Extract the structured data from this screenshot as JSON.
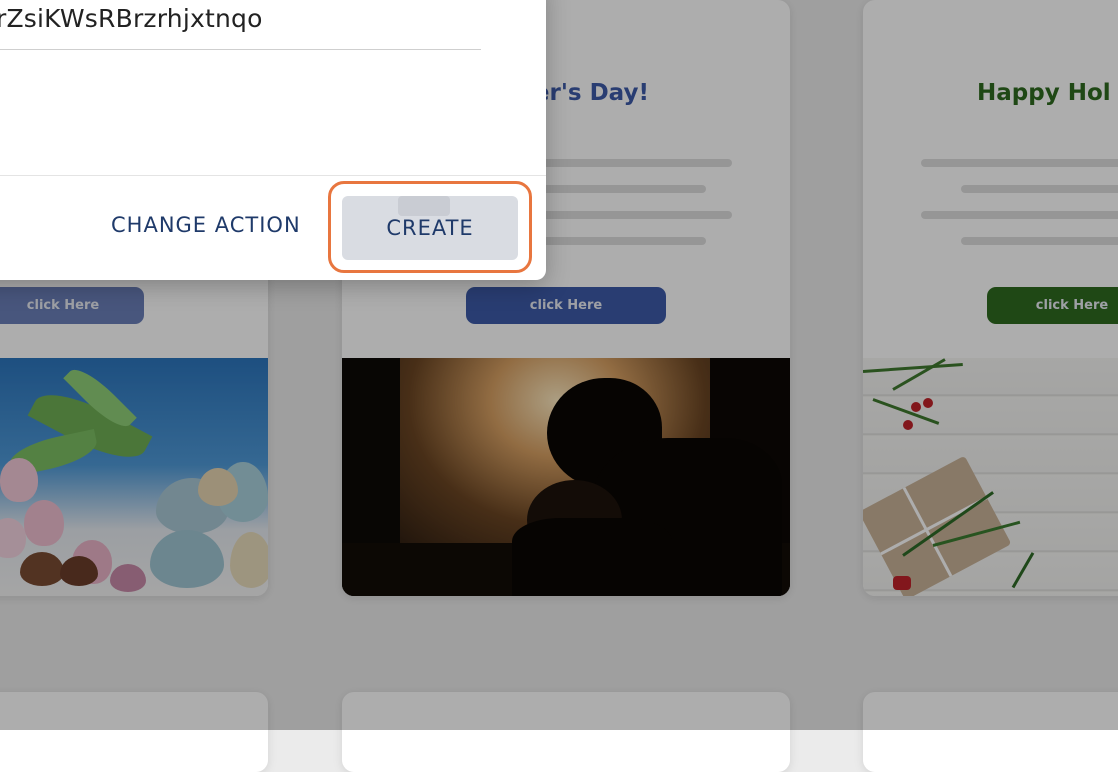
{
  "dialog": {
    "name_value": "rZsiKWsRBrzrhjxtnqo",
    "change_action_label": "CHANGE ACTION",
    "create_label": "CREATE"
  },
  "cards": {
    "left": {
      "cta": "click Here"
    },
    "middle": {
      "title": "ather's Day!",
      "cta": "click Here"
    },
    "right": {
      "title": "Happy Hol",
      "cta": "click Here"
    }
  },
  "colors": {
    "highlight": "#e8763f",
    "button_text": "#1f3a6a",
    "middle_accent": "#3d5ba8",
    "right_accent": "#2e6a1f"
  }
}
